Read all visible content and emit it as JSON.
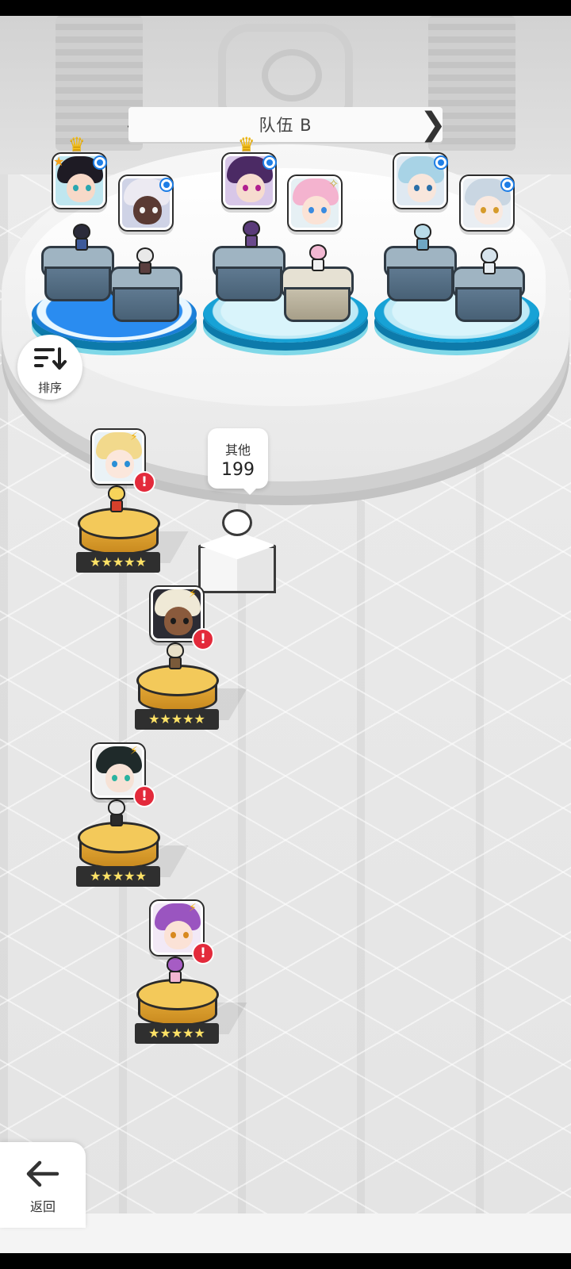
{
  "team": {
    "title": "队伍 B",
    "prev_arrow": "❮",
    "next_arrow": "❯"
  },
  "sort_button": {
    "label": "排序",
    "icon": "sort-descending-icon"
  },
  "others_bubble": {
    "label": "其他",
    "count": "199"
  },
  "back_button": {
    "label": "返回",
    "icon": "arrow-left-icon"
  },
  "hero_list": {
    "star_rating": "★★★★★",
    "alert_mark": "!",
    "energy_mark": "⚡"
  },
  "slot_badges": {
    "crown": "♛",
    "leader_star": "★",
    "sparkle": "✧"
  },
  "colors": {
    "accent_blue": "#1e7ee6",
    "alert_red": "#e32a3b",
    "pedestal_gold": "#f3c95a",
    "pool_cyan": "#17a2d6",
    "star_yellow": "#ffe266"
  }
}
